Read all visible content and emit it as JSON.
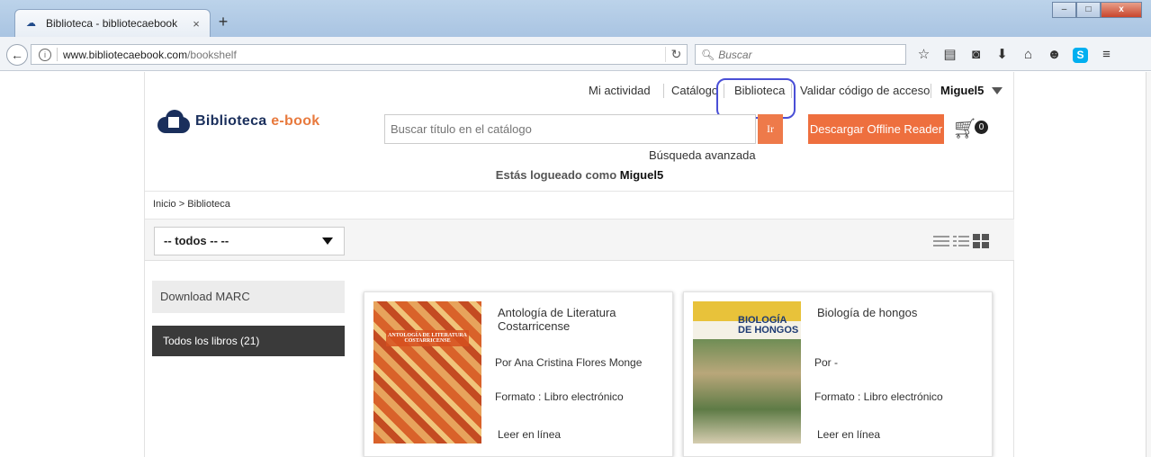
{
  "browser": {
    "tab_title": "Biblioteca - bibliotecaebook",
    "tab_close": "×",
    "new_tab": "+",
    "url_domain": "www.bibliotecaebook.com",
    "url_path": "/bookshelf",
    "search_placeholder": "Buscar",
    "win_minimize": "–",
    "win_maximize": "□",
    "win_close": "x",
    "toolbar_icons": [
      "star-icon",
      "reading-list-icon",
      "pocket-icon",
      "download-icon",
      "home-icon",
      "chat-icon",
      "skype-icon",
      "menu-icon"
    ]
  },
  "topnav": {
    "activity": "Mi actividad",
    "catalog": "Catálogo",
    "library": "Biblioteca",
    "validate": "Validar código de acceso",
    "user": "Miguel5"
  },
  "header": {
    "logo_main": "Biblioteca",
    "logo_accent": "e-book",
    "catalog_search_placeholder": "Buscar título en el catálogo",
    "go_button": "Ir",
    "offline_button": "Descargar Offline Reader",
    "cart_count": "0",
    "advanced_search": "Búsqueda avanzada",
    "logged_prefix": "Estás logueado como",
    "logged_user": "Miguel5"
  },
  "breadcrumb": "Inicio > Biblioteca",
  "filter": {
    "selected": "-- todos -- --"
  },
  "sidebar": {
    "download_marc": "Download MARC",
    "all_books": "Todos los libros (21)"
  },
  "books": [
    {
      "title": "Antología de Literatura Costarricense",
      "author": "Por Ana Cristina Flores Monge",
      "format": "Formato : Libro electrónico",
      "read": "Leer en línea",
      "cover_text": "ANTOLOGÍA DE LITERATURA COSTARRICENSE"
    },
    {
      "title": "Biología de hongos",
      "author": "Por -",
      "format": "Formato : Libro electrónico",
      "read": "Leer en línea",
      "cover_text": "BIOLOGÍA DE HONGOS"
    }
  ]
}
